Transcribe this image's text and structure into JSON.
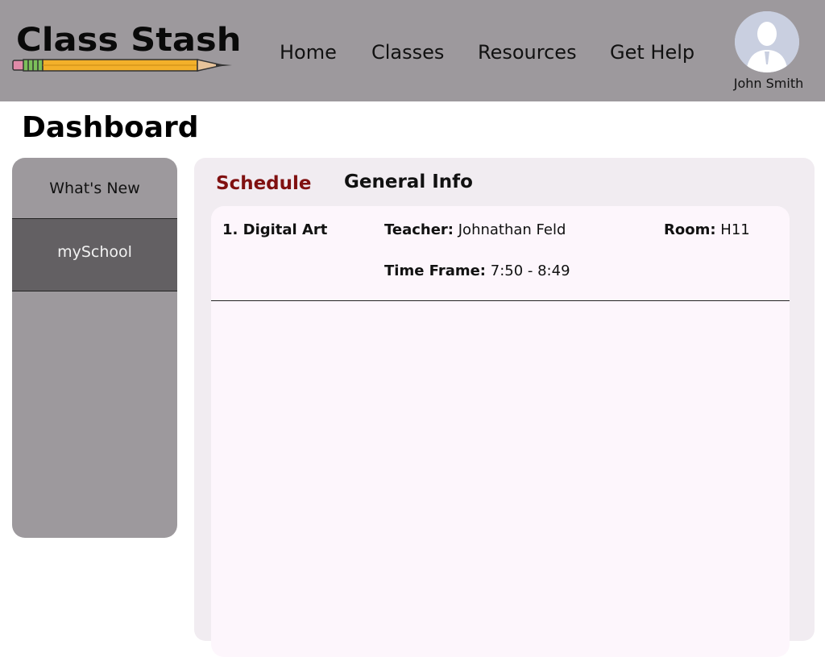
{
  "brand": {
    "name": "Class Stash"
  },
  "nav": {
    "items": [
      "Home",
      "Classes",
      "Resources",
      "Get Help"
    ]
  },
  "user": {
    "name": "John Smith"
  },
  "page": {
    "title": "Dashboard"
  },
  "sidebar": {
    "items": [
      {
        "label": "What's New",
        "active": false
      },
      {
        "label": "mySchool",
        "active": true
      }
    ]
  },
  "tabs": [
    {
      "label": "Schedule",
      "active": true
    },
    {
      "label": "General Info",
      "active": false
    }
  ],
  "schedule": {
    "entries": [
      {
        "class_name": "1. Digital Art",
        "teacher_label": "Teacher:",
        "teacher": "Johnathan Feld",
        "room_label": "Room:",
        "room": "H11",
        "timeframe_label": "Time Frame:",
        "timeframe": "7:50 - 8:49"
      }
    ]
  },
  "colors": {
    "header_bg": "#9d999d",
    "sidebar_bg": "#9d999d",
    "sidebar_active_bg": "#636063",
    "active_tab": "#801010",
    "panel_bg": "#f1ecf1",
    "card_bg": "#fdf6fc"
  },
  "icons": {
    "logo": "pencil-icon",
    "avatar": "user-silhouette-icon"
  }
}
